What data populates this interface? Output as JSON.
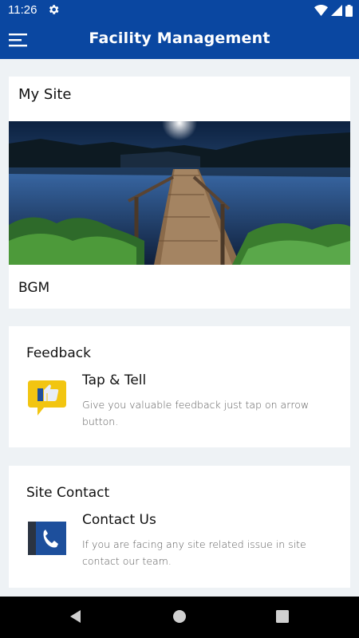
{
  "status_bar": {
    "time": "11:26"
  },
  "app_bar": {
    "title": "Facility Management",
    "menu_icon": "hamburger-menu-icon"
  },
  "my_site": {
    "title": "My Site",
    "site_name": "BGM"
  },
  "feedback": {
    "section_title": "Feedback",
    "item_title": "Tap & Tell",
    "item_description": "Give you valuable feedback just tap on arrow button.",
    "icon": "thumbs-up-speech-bubble-icon"
  },
  "site_contact": {
    "section_title": "Site Contact",
    "item_title": "Contact Us",
    "item_description": "If you are facing any site related issue in site contact our team.",
    "icon": "phone-book-icon"
  },
  "colors": {
    "primary": "#0a47a1",
    "background": "#eef2f5",
    "feedback_icon": "#f2c511",
    "contact_icon": "#1d4f9c"
  }
}
